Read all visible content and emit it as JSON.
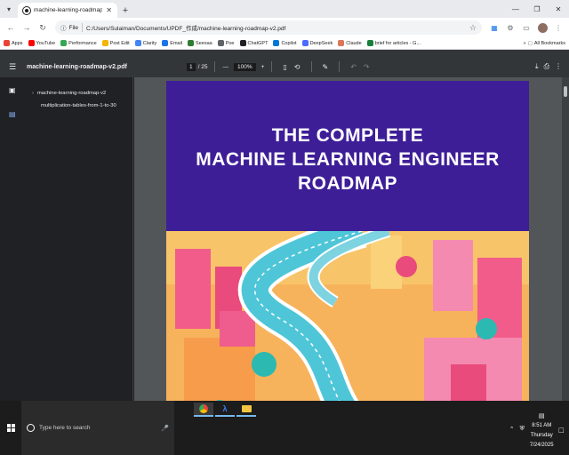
{
  "browser": {
    "tab_title": "machine-learning-roadmap-v2",
    "address_scheme": "File",
    "url": "C:/Users/Sulaiman/Documents/UPDF_作成/machine-learning-roadmap-v2.pdf"
  },
  "bookmarks": [
    {
      "label": "Apps",
      "color": "#ea4335"
    },
    {
      "label": "YouTube",
      "color": "#ff0000"
    },
    {
      "label": "Performance",
      "color": "#34a853"
    },
    {
      "label": "Post Edit",
      "color": "#f4b400"
    },
    {
      "label": "Clarity",
      "color": "#4285f4"
    },
    {
      "label": "Email",
      "color": "#1a73e8"
    },
    {
      "label": "Seesaa",
      "color": "#2e7d32"
    },
    {
      "label": "Poe",
      "color": "#5f6368"
    },
    {
      "label": "ChatGPT",
      "color": "#202124"
    },
    {
      "label": "Copilot",
      "color": "#0078d4"
    },
    {
      "label": "DeepSeek",
      "color": "#4d6bfe"
    },
    {
      "label": "Claude",
      "color": "#d97757"
    },
    {
      "label": "brief for articles - G...",
      "color": "#188038"
    }
  ],
  "bookmarks_more": "All Bookmarks",
  "pdf": {
    "filename": "machine-learning-roadmap-v2.pdf",
    "current_page": "1",
    "total_pages": "/ 25",
    "zoom": "100%"
  },
  "outline": [
    {
      "label": "machine-learning-roadmap-v2"
    },
    {
      "label": "multiplication-tables-from-1-to-30"
    }
  ],
  "cover": {
    "line1": "THE COMPLETE",
    "line2": "MACHINE LEARNING ENGINEER",
    "line3": "ROADMAP",
    "bg_color": "#3d1e97"
  },
  "taskbar": {
    "search_placeholder": "Type here to search",
    "time": "8:51 AM",
    "day": "Thursday",
    "date": "7/24/2025"
  }
}
